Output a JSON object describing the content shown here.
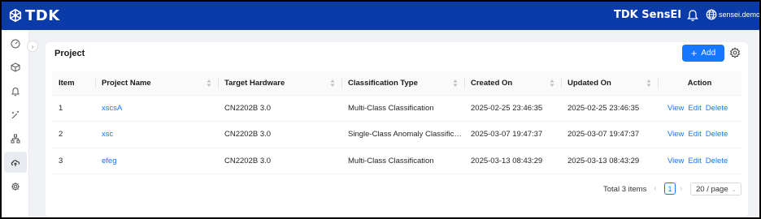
{
  "header": {
    "logo_text": "TDK",
    "app_title": "TDK SensEI",
    "user": "sensei.demo"
  },
  "sidebar": {
    "items": [
      {
        "icon": "dashboard-icon",
        "active": false
      },
      {
        "icon": "cube-icon",
        "active": false
      },
      {
        "icon": "bell-icon",
        "active": false
      },
      {
        "icon": "magic-wand-icon",
        "active": false
      },
      {
        "icon": "hierarchy-icon",
        "active": false
      },
      {
        "icon": "cloud-upload-icon",
        "active": true
      },
      {
        "icon": "gear-icon",
        "active": false
      }
    ]
  },
  "card": {
    "title": "Project",
    "add_label": "Add"
  },
  "table": {
    "columns": [
      "Item",
      "Project Name",
      "Target Hardware",
      "Classification Type",
      "Created On",
      "Updated On",
      "Action"
    ],
    "rows": [
      {
        "item": "1",
        "name": "xscsA",
        "hardware": "CN2202B 3.0",
        "type": "Multi-Class Classification",
        "created": "2025-02-25 23:46:35",
        "updated": "2025-02-25 23:46:35"
      },
      {
        "item": "2",
        "name": "xsc",
        "hardware": "CN2202B 3.0",
        "type": "Single-Class Anomaly Classificati...",
        "created": "2025-03-07 19:47:37",
        "updated": "2025-03-07 19:47:37"
      },
      {
        "item": "3",
        "name": "efeg",
        "hardware": "CN2202B 3.0",
        "type": "Multi-Class Classification",
        "created": "2025-03-13 08:43:29",
        "updated": "2025-03-13 08:43:29"
      }
    ],
    "action_labels": {
      "view": "View",
      "edit": "Edit",
      "delete": "Delete"
    }
  },
  "pagination": {
    "total": "Total 3 items",
    "current_page": "1",
    "page_size": "20 / page"
  },
  "colors": {
    "brand": "#0b3ba9",
    "accent": "#1677ff"
  }
}
